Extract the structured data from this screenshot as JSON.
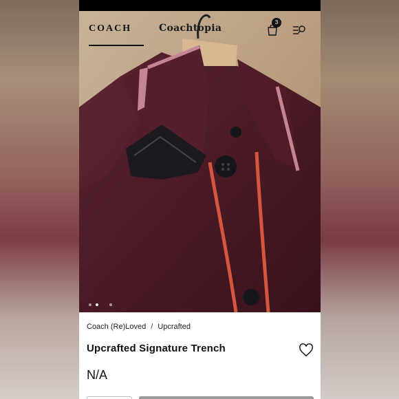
{
  "header": {
    "brand": "COACH",
    "sub_brand": "Coachtopia",
    "cart_count": "3",
    "icons": {
      "cart": "shopping-bag-icon",
      "menu": "menu-search-icon"
    }
  },
  "gallery": {
    "image_alt": "Upcrafted Signature Trench",
    "dots": 4,
    "active_dot": 1
  },
  "breadcrumb": {
    "items": [
      "Coach (Re)Loved",
      "Upcrafted"
    ],
    "separator": "/"
  },
  "product": {
    "name": "Upcrafted Signature Trench",
    "price": "N/A",
    "favorite_icon": "heart-icon"
  },
  "colors": {
    "trench": "#4a1a24",
    "trim_pink": "#c58592",
    "trim_red": "#d4563f",
    "background": "#b89b7a"
  }
}
